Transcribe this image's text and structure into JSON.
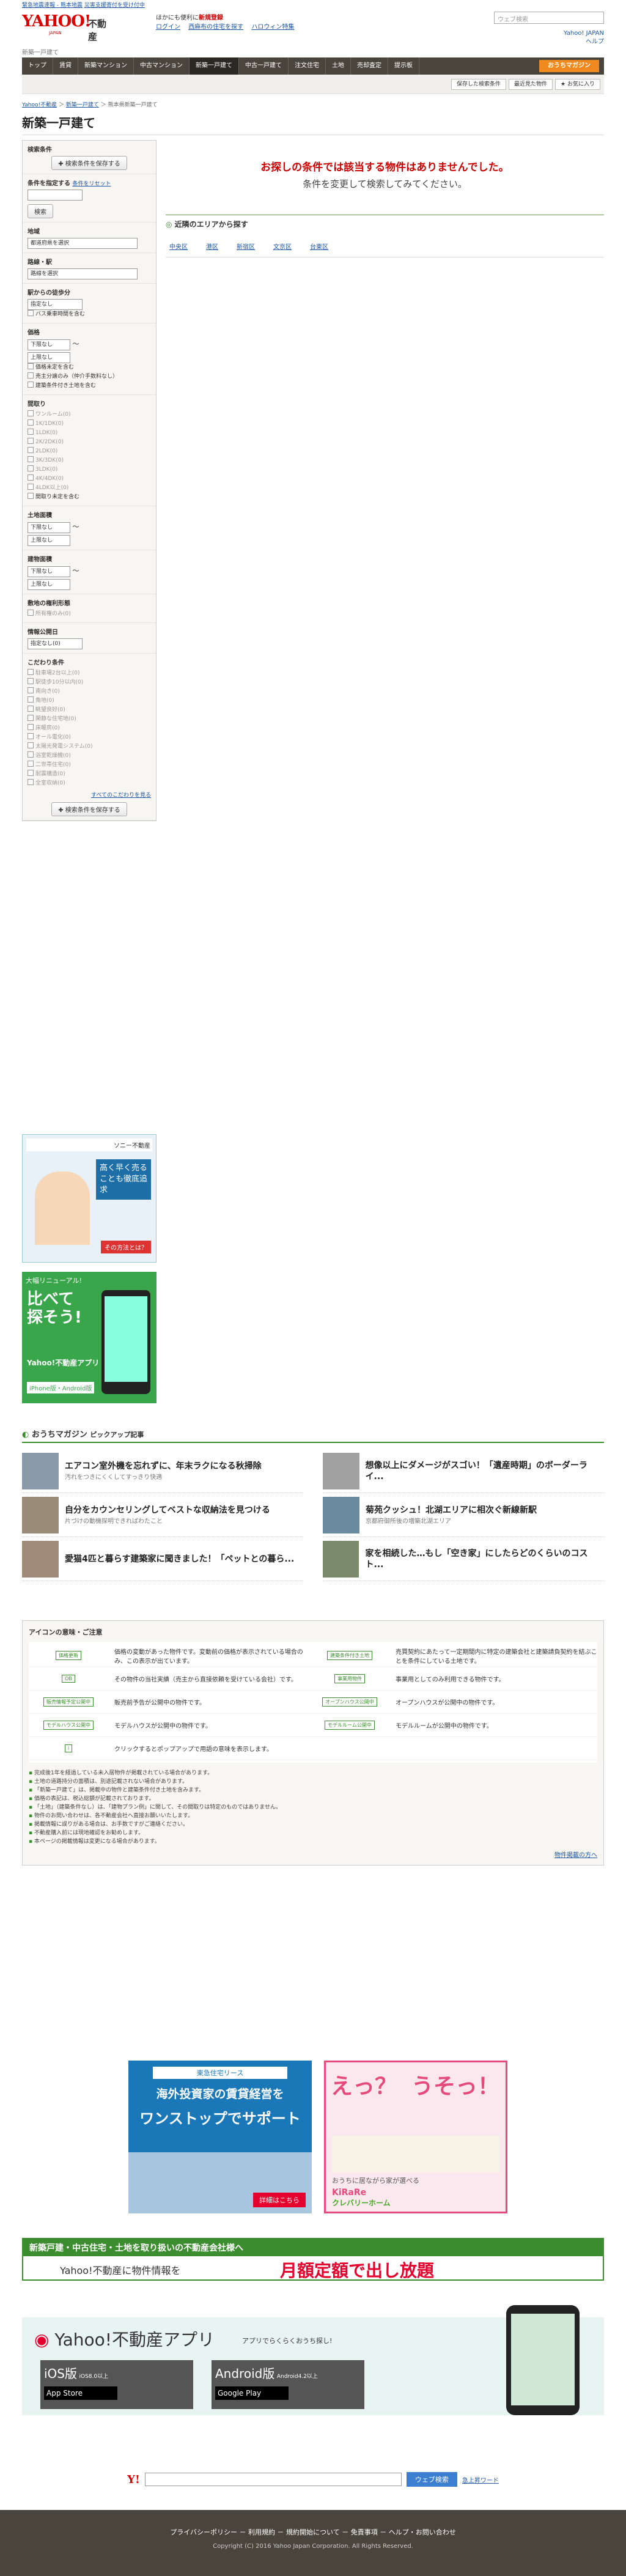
{
  "topline": [
    "緊急地震速報 - 熊本地震",
    "災害支援寄付を受け付中"
  ],
  "logo": {
    "yahoo": "YAHOO!",
    "japan": "JAPAN",
    "fudosan": "不動産"
  },
  "promo": {
    "line1a": "ほかにも便利に",
    "line1b": "新規登録",
    "line2a": "ログイン",
    "line2b": "西麻布の住宅を探す",
    "line2c": "ハロウィン特集"
  },
  "search_placeholder": "ウェブ検索",
  "hright": [
    "Yahoo! JAPAN",
    "ヘルプ"
  ],
  "subtitle": "新築一戸建て",
  "gnav": [
    "トップ",
    "賃貸",
    "新築マンション",
    "中古マンション",
    "新築一戸建て",
    "中古一戸建て",
    "注文住宅",
    "土地",
    "売却査定",
    "提示板"
  ],
  "osu": "おうちマガジン",
  "subbar": [
    "保存した検索条件",
    "最近見た物件",
    "お気に入り"
  ],
  "crumb": [
    "Yahoo!不動産",
    "新築一戸建て",
    "熊本県新築一戸建て"
  ],
  "title": "新築一戸建て",
  "side": {
    "s1": "検索条件",
    "save": "検索条件を保存する",
    "s2": "条件を指定する",
    "reset": "条件をリセット",
    "go": "検索",
    "area": "地域",
    "area_val": "都道府県を選択",
    "line": "路線・駅",
    "line_val": "路線を選択",
    "walk": "駅からの徒歩分",
    "walk_val": "指定なし",
    "bus": "バス乗車時間を含む",
    "price": "価格",
    "p_min": "下限なし",
    "p_max": "上限なし",
    "p_c1": "価格未定を含む",
    "p_c2": "売主分譲のみ（仲介手数料なし）",
    "p_c3": "建築条件付き土地を含む",
    "madori": "間取り",
    "madori_items": [
      "ワンルーム(0)",
      "1K/1DK(0)",
      "1LDK(0)",
      "2K/2DK(0)",
      "2LDK(0)",
      "3K/3DK(0)",
      "3LDK(0)",
      "4K/4DK(0)",
      "4LDK以上(0)"
    ],
    "madori_c": "間取り未定を含む",
    "land": "土地面積",
    "land_min": "下限なし",
    "land_max": "上限なし",
    "bld": "建物面積",
    "bld_min": "下限なし",
    "bld_max": "上限なし",
    "sold": "敷地の権利形態",
    "sold_c": "所有権のみ(0)",
    "pub": "情報公開日",
    "pub_val": "指定なし(0)",
    "kodawari": "こだわり条件",
    "kod_items": [
      "駐車場2台以上(0)",
      "駅徒歩10分以内(0)",
      "南向き(0)",
      "角地(0)",
      "眺望良好(0)",
      "閑静な住宅地(0)",
      "床暖房(0)",
      "オール電化(0)",
      "太陽光発電システム(0)",
      "浴室乾燥機(0)",
      "二世帯住宅(0)",
      "耐震構造(0)",
      "全室収納(0)"
    ],
    "more": "すべてのこだわりを見る",
    "save2": "検索条件を保存する"
  },
  "nohit": {
    "t1": "お探しの条件では該当する物件はありませんでした。",
    "t2": "条件を変更して検索してみてください。"
  },
  "near": {
    "title": "近隣のエリアから探す",
    "items": [
      "中央区",
      "港区",
      "新宿区",
      "文京区",
      "台東区"
    ]
  },
  "ad1": {
    "brand": "ソニー不動産",
    "t": "高く早く売ることも徹底追求",
    "cta": "その方法とは？"
  },
  "ad2": {
    "t1": "大幅リニューアル!",
    "t2": "比べて探そう!",
    "t3": "Yahoo!不動産アプリ",
    "t4": "iPhone版・Android版"
  },
  "mag": {
    "title": "おうちマガジン",
    "sub": "ピックアップ記事",
    "arts": [
      {
        "t": "エアコン室外機を忘れずに、年末ラクになる秋掃除",
        "s": "汚れをつきにくくしてすっきり快適"
      },
      {
        "t": "想像以上にダメージがスゴい！「遺産時期」のボーダーライ...",
        "s": ""
      },
      {
        "t": "自分をカウンセリングしてベストな収納法を見つける",
        "s": "片づけの動機探明できればわたこと"
      },
      {
        "t": "菊苑クッシュ！北湖エリアに相次ぐ新線新駅",
        "s": "京都府御所後の増築北湖エリア"
      },
      {
        "t": "愛猫4匹と暮らす建築家に聞きました！「ペットとの暮ら...",
        "s": ""
      },
      {
        "t": "家を相続した…もし「空き家」にしたらどのくらいのコスト...",
        "s": ""
      }
    ]
  },
  "legend": {
    "title": "アイコンの意味・ご注意",
    "rows": [
      {
        "tag": "価格更新",
        "tx": "価格の変動があった物件です。変動前の価格が表示されている場合のみ、この表示が出ています。",
        "tag2": "建築条件付き土地",
        "tx2": "売買契約にあたって一定期間内に特定の建築会社と建築請負契約を結ぶことを条件にしている土地です。"
      },
      {
        "tag": "OB",
        "tx": "その物件の当社実績（売主から直接依頼を受けている会社）です。",
        "tag2": "事業用物件",
        "tx2": "事業用としてのみ利用できる物件です。"
      },
      {
        "tag": "販売情報予定公開中",
        "tx": "販売前予告が公開中の物件です。",
        "tag2": "オープンハウス公開中",
        "tx2": "オープンハウスが公開中の物件です。"
      },
      {
        "tag": "モデルハウス公開中",
        "tx": "モデルハウスが公開中の物件です。",
        "tag2": "モデルルーム公開中",
        "tx2": "モデルルームが公開中の物件です。"
      },
      {
        "tag": "i",
        "tx": "クリックするとポップアップで用語の意味を表示します。",
        "tag2": "",
        "tx2": ""
      }
    ],
    "notes": [
      "完成後1年を経過している未入居物件が掲載されている場合があります。",
      "土地の道路持分の面積は、別途記載されない場合があります。",
      "「新築一戸建て」は、掲載中の物件と建築条件付き土地を含みます。",
      "価格の表記は、税込総額が記載されております。",
      "「土地」（建築条件なし）は、「建物プラン例」に関して、その間取りは特定のものではありません。",
      "物件のお問い合わせは、各不動産会社へ直接お願いいたします。",
      "掲載情報に誤りがある場合は、お手数ですがご連絡ください。",
      "不動産購入前には現地確認をお勧めします。",
      "本ページの掲載情報は変更になる場合があります。"
    ],
    "link": "物件掲載の方へ"
  },
  "ads_mid": {
    "a": {
      "t1": "東急住宅リース",
      "t2": "海外投資家の賃貸経営を",
      "t3": "ワンストップでサポート",
      "t4": "詳細はこちら"
    },
    "b": {
      "t1": "えっ？",
      "t2": "うそっ！",
      "t3": "おうちに居ながら家が選べる",
      "t4": "KiRaRe",
      "t5": "クレバリーホーム"
    }
  },
  "banner": {
    "t1": "新築戸建・中古住宅・土地を取り扱いの不動産会社様へ",
    "t2": "Yahoo!不動産に物件情報を",
    "t3": "月額定額で出し放題"
  },
  "app": {
    "title": "Yahoo!不動産アプリ",
    "sub": "アプリでらくらくおうち探し!",
    "ios": "iOS版",
    "ios_v": "iOS8.0以上",
    "android": "Android版",
    "and_v": "Android4.2以上",
    "store": "App Store",
    "gp": "Google Play"
  },
  "foot_search": {
    "btn": "ウェブ検索",
    "link": "急上昇ワード"
  },
  "footer": {
    "links": "プライバシーポリシー － 利用規約 － 規約開始について － 免責事項 － ヘルプ・お問い合わせ",
    "cp": "Copyright (C) 2016 Yahoo Japan Corporation. All Rights Reserved."
  }
}
